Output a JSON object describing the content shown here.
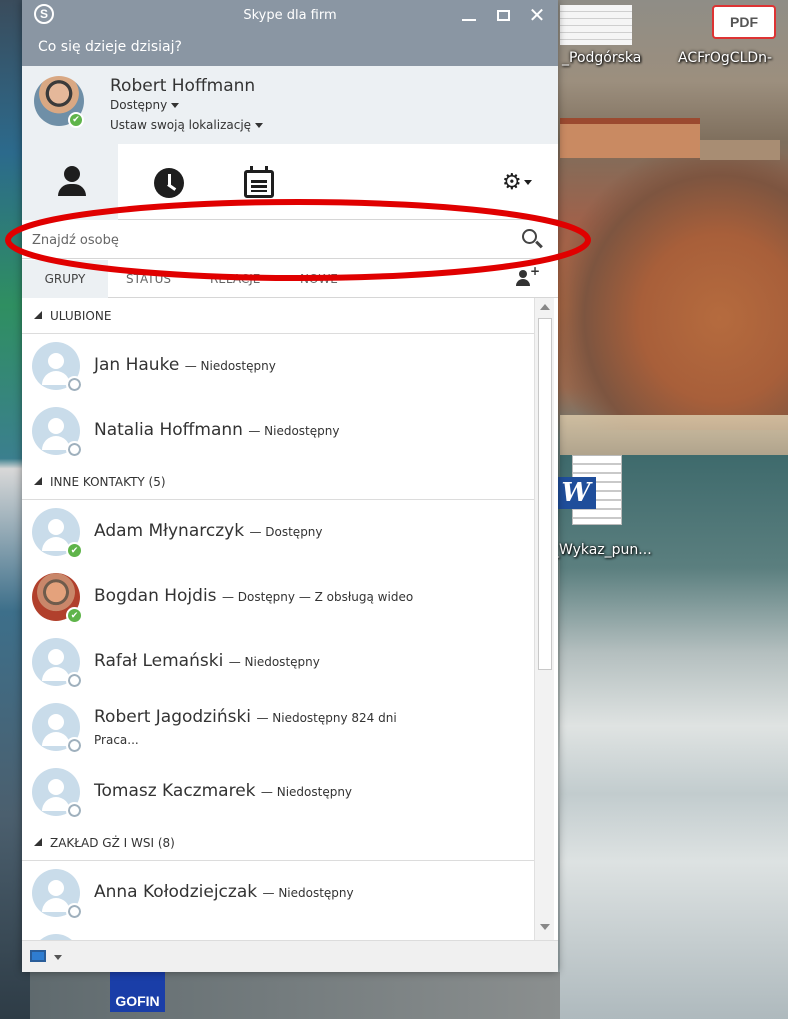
{
  "desktop": {
    "icons": [
      {
        "id": "podgorska",
        "label": "_Podgórska"
      },
      {
        "id": "pdf",
        "label": "ACFrOgCLDn-",
        "badge": "PDF"
      },
      {
        "id": "word",
        "label": "_Wykaz_pun...",
        "badge": "W"
      },
      {
        "id": "gofin",
        "label": "GOFIN"
      }
    ]
  },
  "window": {
    "title": "Skype dla firm",
    "controls": {
      "minimize": "–",
      "maximize": "□",
      "close": "✕"
    }
  },
  "mood": {
    "placeholder_text": "Co się dzieje dzisiaj?"
  },
  "profile": {
    "name": "Robert Hoffmann",
    "status": "Dostępny",
    "location": "Ustaw swoją lokalizację",
    "presence_color": "#5fb44a"
  },
  "tabs": [
    {
      "id": "contacts",
      "icon": "person-icon",
      "selected": true
    },
    {
      "id": "conversations",
      "icon": "clock-icon",
      "selected": false
    },
    {
      "id": "meetings",
      "icon": "calendar-icon",
      "selected": false
    },
    {
      "id": "options",
      "icon": "gear-icon",
      "selected": false
    }
  ],
  "search": {
    "placeholder": "Znajdź osobę",
    "value": ""
  },
  "filter_tabs": {
    "groups": "GRUPY",
    "status": "STATUS",
    "relations": "RELACJE",
    "new": "NOWE"
  },
  "groups": [
    {
      "title": "ULUBIONE",
      "contacts": [
        {
          "name": "Jan Hauke",
          "status": "— Niedostępny",
          "presence": "offline"
        },
        {
          "name": "Natalia Hoffmann",
          "status": "— Niedostępny",
          "presence": "offline"
        }
      ]
    },
    {
      "title": "INNE KONTAKTY (5)",
      "contacts": [
        {
          "name": "Adam Młynarczyk",
          "status": "— Dostępny",
          "presence": "online"
        },
        {
          "name": "Bogdan Hojdis",
          "status": "— Dostępny — Z obsługą wideo",
          "presence": "online",
          "photo": true
        },
        {
          "name": "Rafał Lemański",
          "status": "— Niedostępny",
          "presence": "offline"
        },
        {
          "name": "Robert Jagodziński",
          "status": "— Niedostępny 824 dni",
          "note": "Praca...",
          "presence": "offline"
        },
        {
          "name": "Tomasz Kaczmarek",
          "status": "— Niedostępny",
          "presence": "offline"
        }
      ]
    },
    {
      "title": "ZAKŁAD GŻ I WSI (8)",
      "contacts": [
        {
          "name": "Anna Kołodziejczak",
          "status": "— Niedostępny",
          "presence": "offline"
        }
      ]
    }
  ],
  "colors": {
    "titlebar": "#8a96a3",
    "header_bg": "#ecf0f3",
    "online": "#5fb44a",
    "avatar_placeholder": "#c9dcea",
    "annotation": "#e00000"
  }
}
